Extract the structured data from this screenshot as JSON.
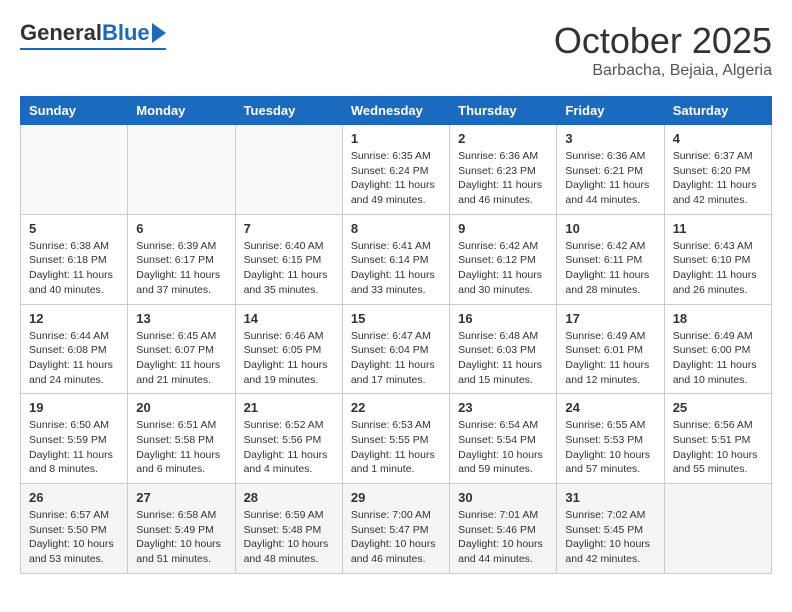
{
  "header": {
    "logo_general": "General",
    "logo_blue": "Blue",
    "month_title": "October 2025",
    "location": "Barbacha, Bejaia, Algeria"
  },
  "weekdays": [
    "Sunday",
    "Monday",
    "Tuesday",
    "Wednesday",
    "Thursday",
    "Friday",
    "Saturday"
  ],
  "weeks": [
    [
      {
        "day": "",
        "info": ""
      },
      {
        "day": "",
        "info": ""
      },
      {
        "day": "",
        "info": ""
      },
      {
        "day": "1",
        "info": "Sunrise: 6:35 AM\nSunset: 6:24 PM\nDaylight: 11 hours\nand 49 minutes."
      },
      {
        "day": "2",
        "info": "Sunrise: 6:36 AM\nSunset: 6:23 PM\nDaylight: 11 hours\nand 46 minutes."
      },
      {
        "day": "3",
        "info": "Sunrise: 6:36 AM\nSunset: 6:21 PM\nDaylight: 11 hours\nand 44 minutes."
      },
      {
        "day": "4",
        "info": "Sunrise: 6:37 AM\nSunset: 6:20 PM\nDaylight: 11 hours\nand 42 minutes."
      }
    ],
    [
      {
        "day": "5",
        "info": "Sunrise: 6:38 AM\nSunset: 6:18 PM\nDaylight: 11 hours\nand 40 minutes."
      },
      {
        "day": "6",
        "info": "Sunrise: 6:39 AM\nSunset: 6:17 PM\nDaylight: 11 hours\nand 37 minutes."
      },
      {
        "day": "7",
        "info": "Sunrise: 6:40 AM\nSunset: 6:15 PM\nDaylight: 11 hours\nand 35 minutes."
      },
      {
        "day": "8",
        "info": "Sunrise: 6:41 AM\nSunset: 6:14 PM\nDaylight: 11 hours\nand 33 minutes."
      },
      {
        "day": "9",
        "info": "Sunrise: 6:42 AM\nSunset: 6:12 PM\nDaylight: 11 hours\nand 30 minutes."
      },
      {
        "day": "10",
        "info": "Sunrise: 6:42 AM\nSunset: 6:11 PM\nDaylight: 11 hours\nand 28 minutes."
      },
      {
        "day": "11",
        "info": "Sunrise: 6:43 AM\nSunset: 6:10 PM\nDaylight: 11 hours\nand 26 minutes."
      }
    ],
    [
      {
        "day": "12",
        "info": "Sunrise: 6:44 AM\nSunset: 6:08 PM\nDaylight: 11 hours\nand 24 minutes."
      },
      {
        "day": "13",
        "info": "Sunrise: 6:45 AM\nSunset: 6:07 PM\nDaylight: 11 hours\nand 21 minutes."
      },
      {
        "day": "14",
        "info": "Sunrise: 6:46 AM\nSunset: 6:05 PM\nDaylight: 11 hours\nand 19 minutes."
      },
      {
        "day": "15",
        "info": "Sunrise: 6:47 AM\nSunset: 6:04 PM\nDaylight: 11 hours\nand 17 minutes."
      },
      {
        "day": "16",
        "info": "Sunrise: 6:48 AM\nSunset: 6:03 PM\nDaylight: 11 hours\nand 15 minutes."
      },
      {
        "day": "17",
        "info": "Sunrise: 6:49 AM\nSunset: 6:01 PM\nDaylight: 11 hours\nand 12 minutes."
      },
      {
        "day": "18",
        "info": "Sunrise: 6:49 AM\nSunset: 6:00 PM\nDaylight: 11 hours\nand 10 minutes."
      }
    ],
    [
      {
        "day": "19",
        "info": "Sunrise: 6:50 AM\nSunset: 5:59 PM\nDaylight: 11 hours\nand 8 minutes."
      },
      {
        "day": "20",
        "info": "Sunrise: 6:51 AM\nSunset: 5:58 PM\nDaylight: 11 hours\nand 6 minutes."
      },
      {
        "day": "21",
        "info": "Sunrise: 6:52 AM\nSunset: 5:56 PM\nDaylight: 11 hours\nand 4 minutes."
      },
      {
        "day": "22",
        "info": "Sunrise: 6:53 AM\nSunset: 5:55 PM\nDaylight: 11 hours\nand 1 minute."
      },
      {
        "day": "23",
        "info": "Sunrise: 6:54 AM\nSunset: 5:54 PM\nDaylight: 10 hours\nand 59 minutes."
      },
      {
        "day": "24",
        "info": "Sunrise: 6:55 AM\nSunset: 5:53 PM\nDaylight: 10 hours\nand 57 minutes."
      },
      {
        "day": "25",
        "info": "Sunrise: 6:56 AM\nSunset: 5:51 PM\nDaylight: 10 hours\nand 55 minutes."
      }
    ],
    [
      {
        "day": "26",
        "info": "Sunrise: 6:57 AM\nSunset: 5:50 PM\nDaylight: 10 hours\nand 53 minutes."
      },
      {
        "day": "27",
        "info": "Sunrise: 6:58 AM\nSunset: 5:49 PM\nDaylight: 10 hours\nand 51 minutes."
      },
      {
        "day": "28",
        "info": "Sunrise: 6:59 AM\nSunset: 5:48 PM\nDaylight: 10 hours\nand 48 minutes."
      },
      {
        "day": "29",
        "info": "Sunrise: 7:00 AM\nSunset: 5:47 PM\nDaylight: 10 hours\nand 46 minutes."
      },
      {
        "day": "30",
        "info": "Sunrise: 7:01 AM\nSunset: 5:46 PM\nDaylight: 10 hours\nand 44 minutes."
      },
      {
        "day": "31",
        "info": "Sunrise: 7:02 AM\nSunset: 5:45 PM\nDaylight: 10 hours\nand 42 minutes."
      },
      {
        "day": "",
        "info": ""
      }
    ]
  ]
}
